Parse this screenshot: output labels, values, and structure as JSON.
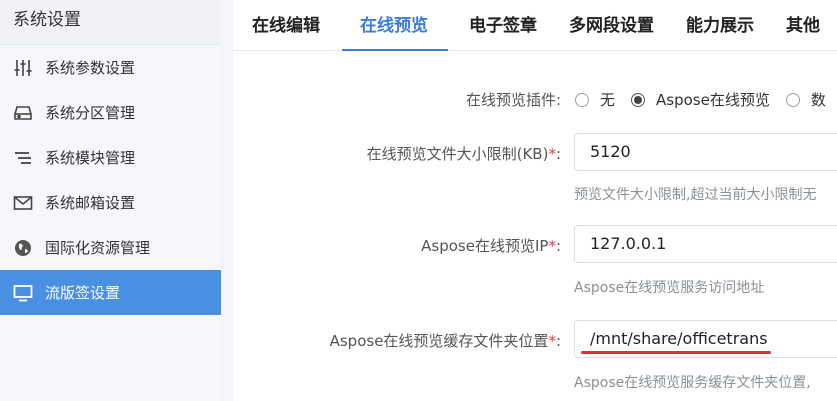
{
  "sidebar": {
    "title": "系统设置",
    "items": [
      {
        "label": "系统参数设置",
        "icon": "sliders-icon"
      },
      {
        "label": "系统分区管理",
        "icon": "hard-drive-icon"
      },
      {
        "label": "系统模块管理",
        "icon": "list-icon"
      },
      {
        "label": "系统邮箱设置",
        "icon": "mail-icon"
      },
      {
        "label": "国际化资源管理",
        "icon": "globe-icon"
      },
      {
        "label": "流版签设置",
        "icon": "monitor-icon"
      }
    ]
  },
  "tabs": [
    {
      "label": "在线编辑"
    },
    {
      "label": "在线预览"
    },
    {
      "label": "电子签章"
    },
    {
      "label": "多网段设置"
    },
    {
      "label": "能力展示"
    },
    {
      "label": "其他"
    }
  ],
  "form": {
    "plugin": {
      "label": "在线预览插件:",
      "options": [
        "无",
        "Aspose在线预览",
        "数"
      ],
      "selected": "Aspose在线预览"
    },
    "size_limit": {
      "label": "在线预览文件大小限制(KB)",
      "required": "*",
      "colon": ":",
      "value": "5120",
      "hint": "预览文件大小限制,超过当前大小限制无"
    },
    "aspose_ip": {
      "label": "Aspose在线预览IP",
      "required": "*",
      "colon": ":",
      "value": "127.0.0.1",
      "hint": "Aspose在线预览服务访问地址"
    },
    "cache_dir": {
      "label": "Aspose在线预览缓存文件夹位置",
      "required": "*",
      "colon": ":",
      "value": "/mnt/share/officetrans",
      "hint": "Aspose在线预览服务缓存文件夹位置,"
    }
  },
  "colors": {
    "accent": "#3b7dd8",
    "active_sidebar": "#4a90e2",
    "required": "#e0393e",
    "highlight_underline": "#e0303a"
  }
}
